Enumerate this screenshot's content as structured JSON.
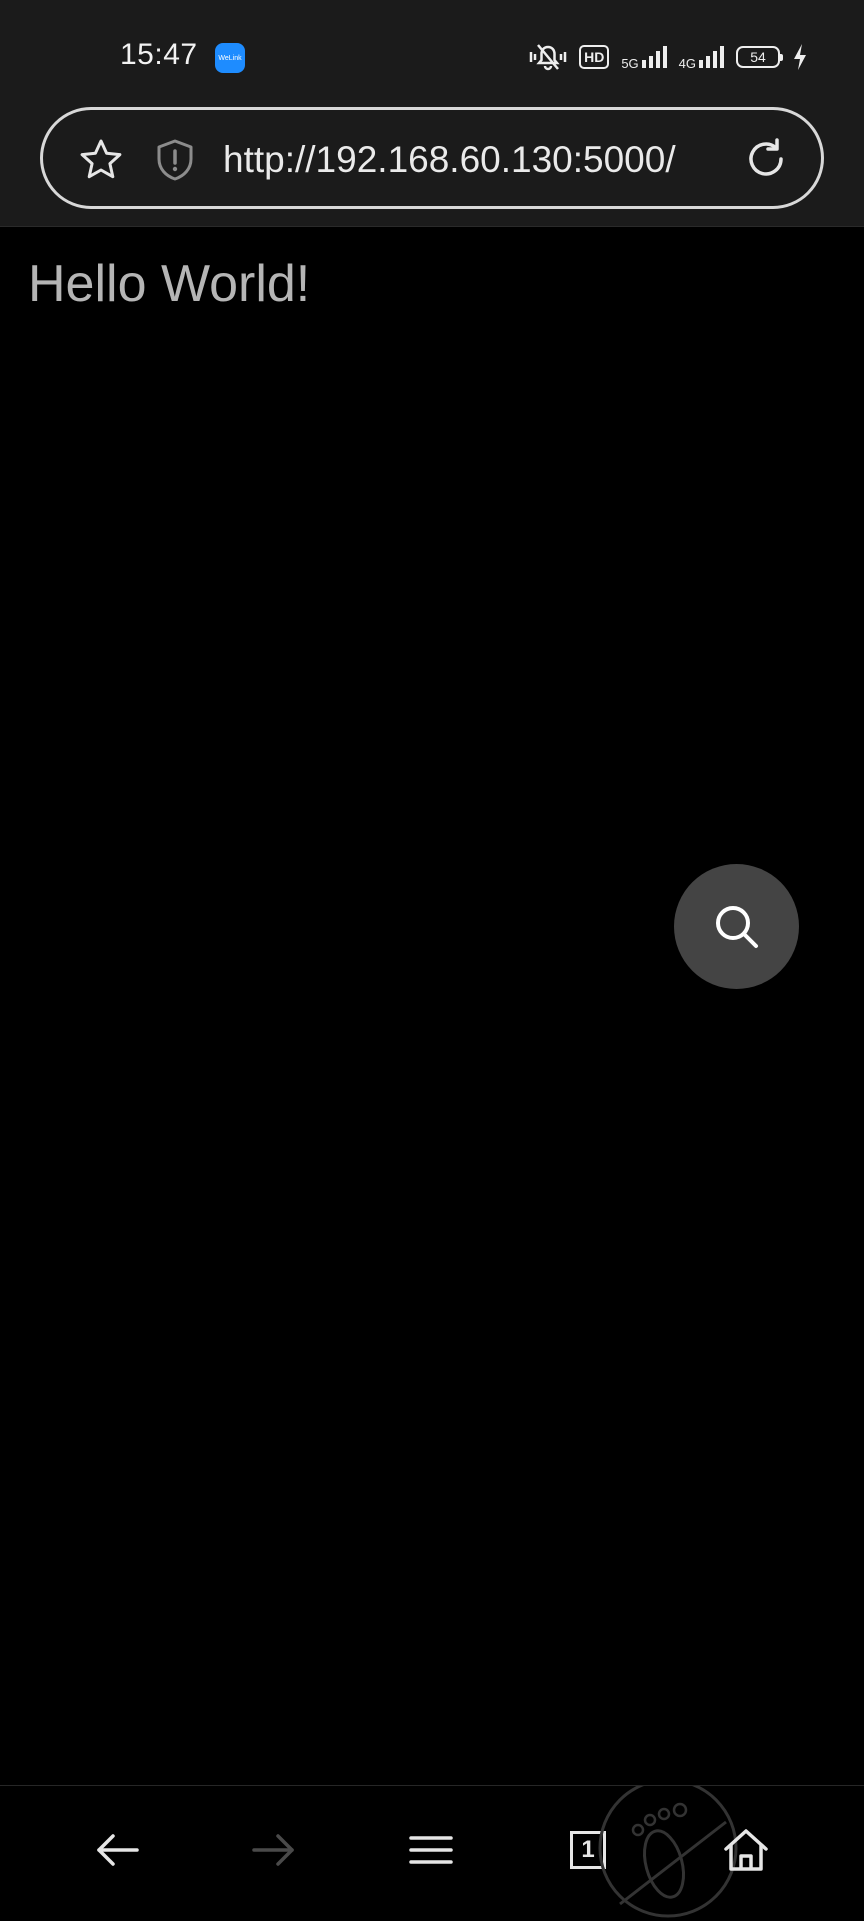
{
  "status_bar": {
    "time": "15:47",
    "app_badge_label": "WeLink",
    "hd_label": "HD",
    "network_5g": "5G",
    "network_4g": "4G",
    "battery_level": "54"
  },
  "address_bar": {
    "url": "http://192.168.60.130:5000/"
  },
  "page": {
    "heading": "Hello World!"
  },
  "bottom_nav": {
    "tab_count": "1"
  },
  "colors": {
    "background": "#000000",
    "chrome": "#1b1b1b",
    "fab": "#444444",
    "heading_text": "#b5b5b5"
  },
  "icons": [
    "star-icon",
    "shield-warning-icon",
    "reload-icon",
    "search-icon",
    "back-arrow-icon",
    "forward-arrow-icon",
    "menu-icon",
    "tabs-icon",
    "home-icon",
    "footprint-icon",
    "mute-icon",
    "signal-icon",
    "charging-icon"
  ]
}
